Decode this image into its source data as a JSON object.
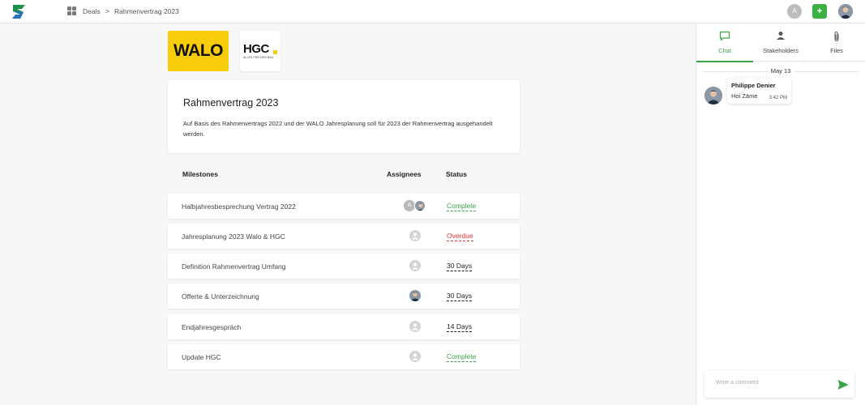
{
  "topbar": {
    "breadcrumb": [
      "Deals",
      "Rahmenvertrag 2023"
    ],
    "breadcrumb_separator": ">",
    "user_initial": "A",
    "add_label": "+"
  },
  "logos": {
    "walo": "WALO",
    "hgc": "HGC",
    "hgc_tagline": "ALLES FÜR DEN BAU"
  },
  "deal": {
    "title": "Rahmenvertrag 2023",
    "description": "Auf Basis des Rahmenvertrags 2022 und der WALO Jahresplanung soll für 2023 der Rahmenvertrag ausgehandelt werden."
  },
  "milestones": {
    "headers": {
      "name": "Milestones",
      "assignees": "Assignees",
      "status": "Status"
    },
    "rows": [
      {
        "name": "Halbjahresbesprechung Vertrag 2022",
        "assignees": "initial+photo",
        "initial": "A",
        "status": "Complete",
        "status_type": "complete"
      },
      {
        "name": "Jahresplanung 2023 Walo & HGC",
        "assignees": "empty",
        "status": "Overdue",
        "status_type": "overdue"
      },
      {
        "name": "Definition Rahmenvertrag Umfang",
        "assignees": "empty",
        "status": "30 Days",
        "status_type": "days"
      },
      {
        "name": "Offerte & Unterzeichnung",
        "assignees": "photo",
        "status": "30 Days",
        "status_type": "days"
      },
      {
        "name": "Endjahresgespräch",
        "assignees": "empty",
        "status": "14 Days",
        "status_type": "days"
      },
      {
        "name": "Update HGC",
        "assignees": "empty",
        "status": "Complete",
        "status_type": "complete"
      }
    ]
  },
  "panel": {
    "tabs": [
      {
        "label": "Chat",
        "icon": "chat-icon",
        "active": true
      },
      {
        "label": "Stakeholders",
        "icon": "person-icon",
        "active": false
      },
      {
        "label": "Files",
        "icon": "paperclip-icon",
        "active": false
      }
    ],
    "date_separator": "May 13",
    "messages": [
      {
        "author": "Philippe Denier",
        "text": "Hoi Zäme",
        "time": "3:42 PM"
      }
    ],
    "comment_placeholder": "Write a comment"
  },
  "colors": {
    "accent": "#3aa547",
    "overdue": "#dd3333",
    "walo_yellow": "#f6cc0b"
  }
}
